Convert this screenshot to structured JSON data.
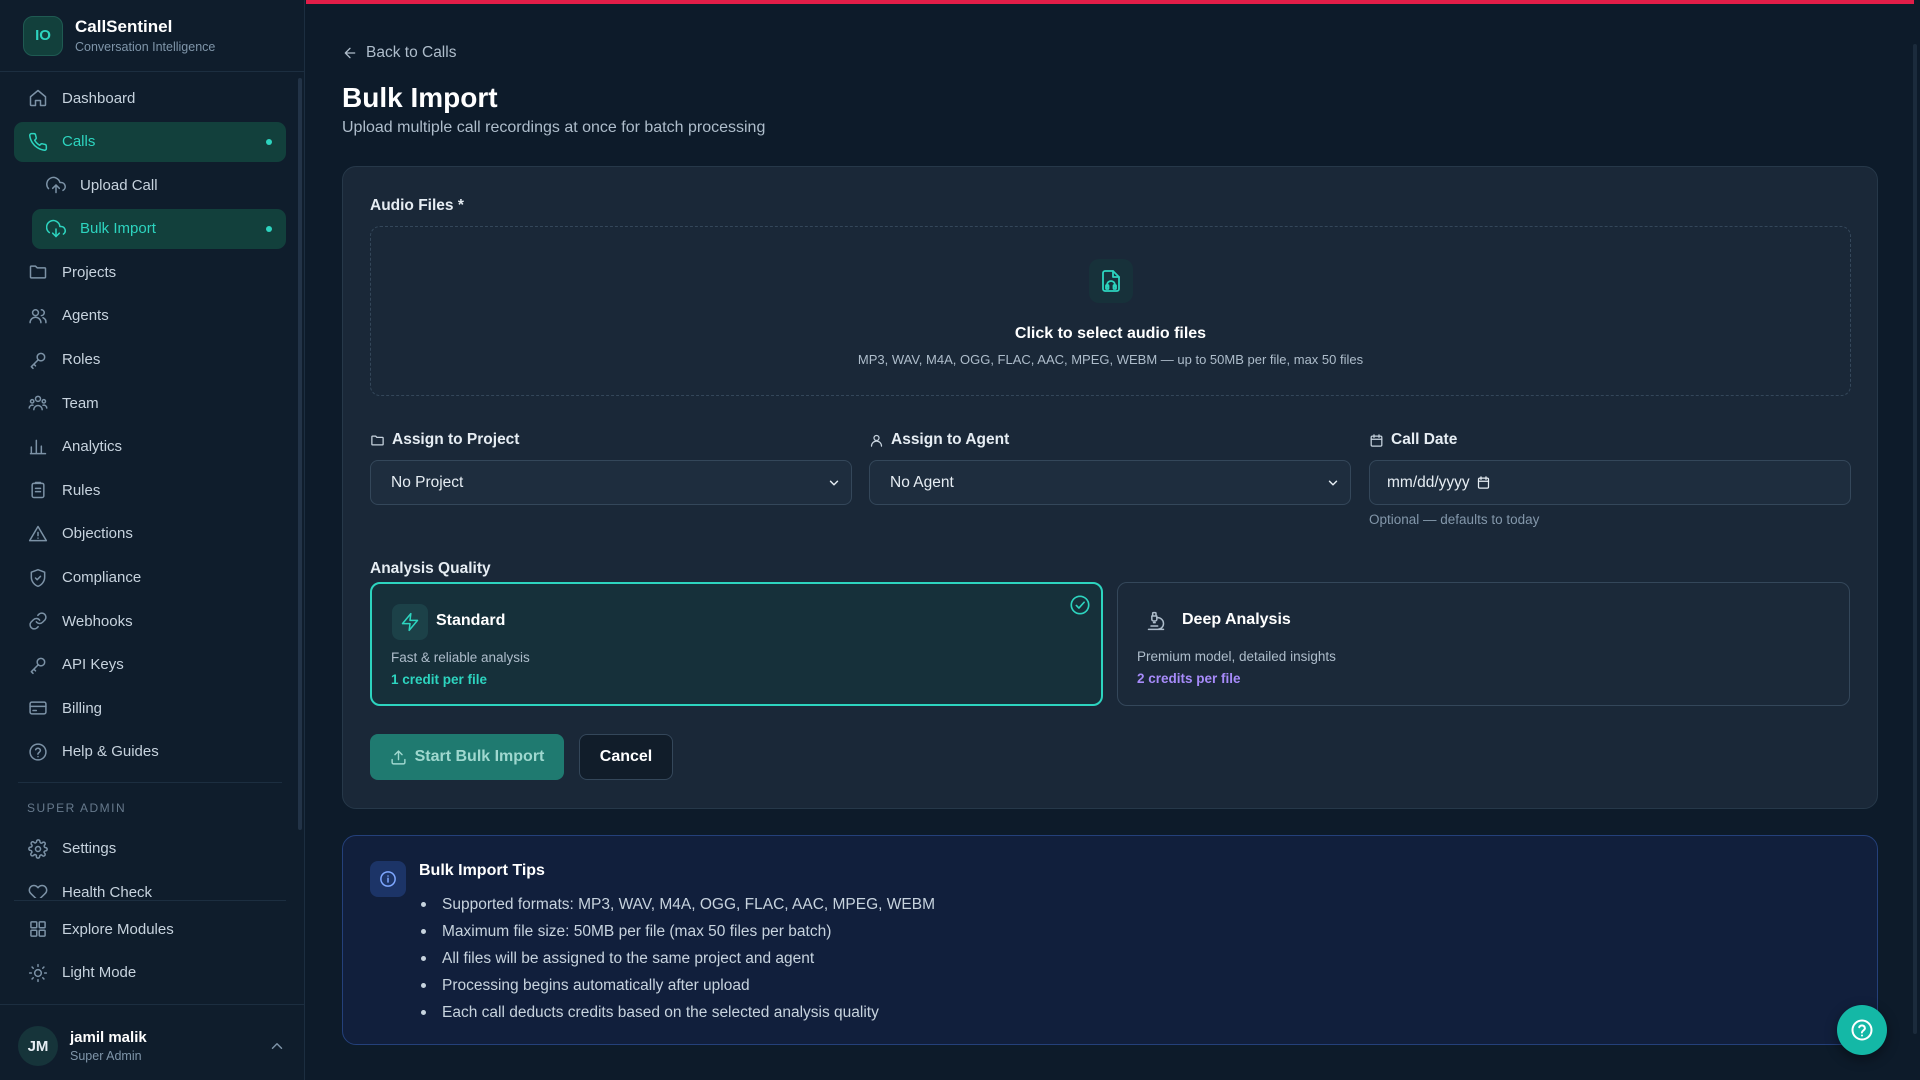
{
  "brand": {
    "logo": "IO",
    "name": "CallSentinel",
    "subtitle": "Conversation Intelligence"
  },
  "nav": {
    "items": [
      {
        "label": "Dashboard",
        "icon": "home-icon"
      },
      {
        "label": "Calls",
        "icon": "phone-icon",
        "active": true
      },
      {
        "label": "Upload Call",
        "icon": "upload-cloud-icon",
        "sub": true
      },
      {
        "label": "Bulk Import",
        "icon": "download-cloud-icon",
        "sub": true,
        "active": true
      },
      {
        "label": "Projects",
        "icon": "folder-icon"
      },
      {
        "label": "Agents",
        "icon": "users-icon"
      },
      {
        "label": "Roles",
        "icon": "key-icon"
      },
      {
        "label": "Team",
        "icon": "team-icon"
      },
      {
        "label": "Analytics",
        "icon": "bar-chart-icon"
      },
      {
        "label": "Rules",
        "icon": "clipboard-icon"
      },
      {
        "label": "Objections",
        "icon": "alert-triangle-icon"
      },
      {
        "label": "Compliance",
        "icon": "shield-icon"
      },
      {
        "label": "Webhooks",
        "icon": "link-icon"
      },
      {
        "label": "API Keys",
        "icon": "key-icon"
      },
      {
        "label": "Billing",
        "icon": "credit-card-icon"
      },
      {
        "label": "Help & Guides",
        "icon": "help-circle-icon"
      }
    ],
    "section_label": "SUPER ADMIN",
    "admin_items": [
      {
        "label": "Settings",
        "icon": "gear-icon"
      },
      {
        "label": "Health Check",
        "icon": "heart-icon"
      }
    ],
    "bottom_items": [
      {
        "label": "Explore Modules",
        "icon": "grid-icon"
      },
      {
        "label": "Light Mode",
        "icon": "sun-icon"
      }
    ]
  },
  "user": {
    "initials": "JM",
    "name": "jamil malik",
    "role": "Super Admin"
  },
  "page": {
    "back_label": "Back to Calls",
    "title": "Bulk Import",
    "subtitle": "Upload multiple call recordings at once for batch processing"
  },
  "form": {
    "files_label": "Audio Files *",
    "dropzone_title": "Click to select audio files",
    "dropzone_hint": "MP3, WAV, M4A, OGG, FLAC, AAC, MPEG, WEBM — up to 50MB per file, max 50 files",
    "project_label": "Assign to Project",
    "project_value": "No Project",
    "agent_label": "Assign to Agent",
    "agent_value": "No Agent",
    "date_label": "Call Date",
    "date_placeholder": "mm/dd/yyyy",
    "date_hint": "Optional — defaults to today",
    "quality_label": "Analysis Quality",
    "quality_options": [
      {
        "title": "Standard",
        "desc": "Fast & reliable analysis",
        "credit": "1 credit per file",
        "selected": true
      },
      {
        "title": "Deep Analysis",
        "desc": "Premium model, detailed insights",
        "credit": "2 credits per file",
        "selected": false
      }
    ],
    "start_label": "Start Bulk Import",
    "cancel_label": "Cancel"
  },
  "tips": {
    "title": "Bulk Import Tips",
    "items": [
      "Supported formats: MP3, WAV, M4A, OGG, FLAC, AAC, MPEG, WEBM",
      "Maximum file size: 50MB per file (max 50 files per batch)",
      "All files will be assigned to the same project and agent",
      "Processing begins automatically after upload",
      "Each call deducts credits based on the selected analysis quality"
    ]
  },
  "colors": {
    "accent": "#2dd4bf",
    "danger_bar": "#e11d48",
    "purple": "#a78bfa",
    "background": "#0d1b2a"
  }
}
